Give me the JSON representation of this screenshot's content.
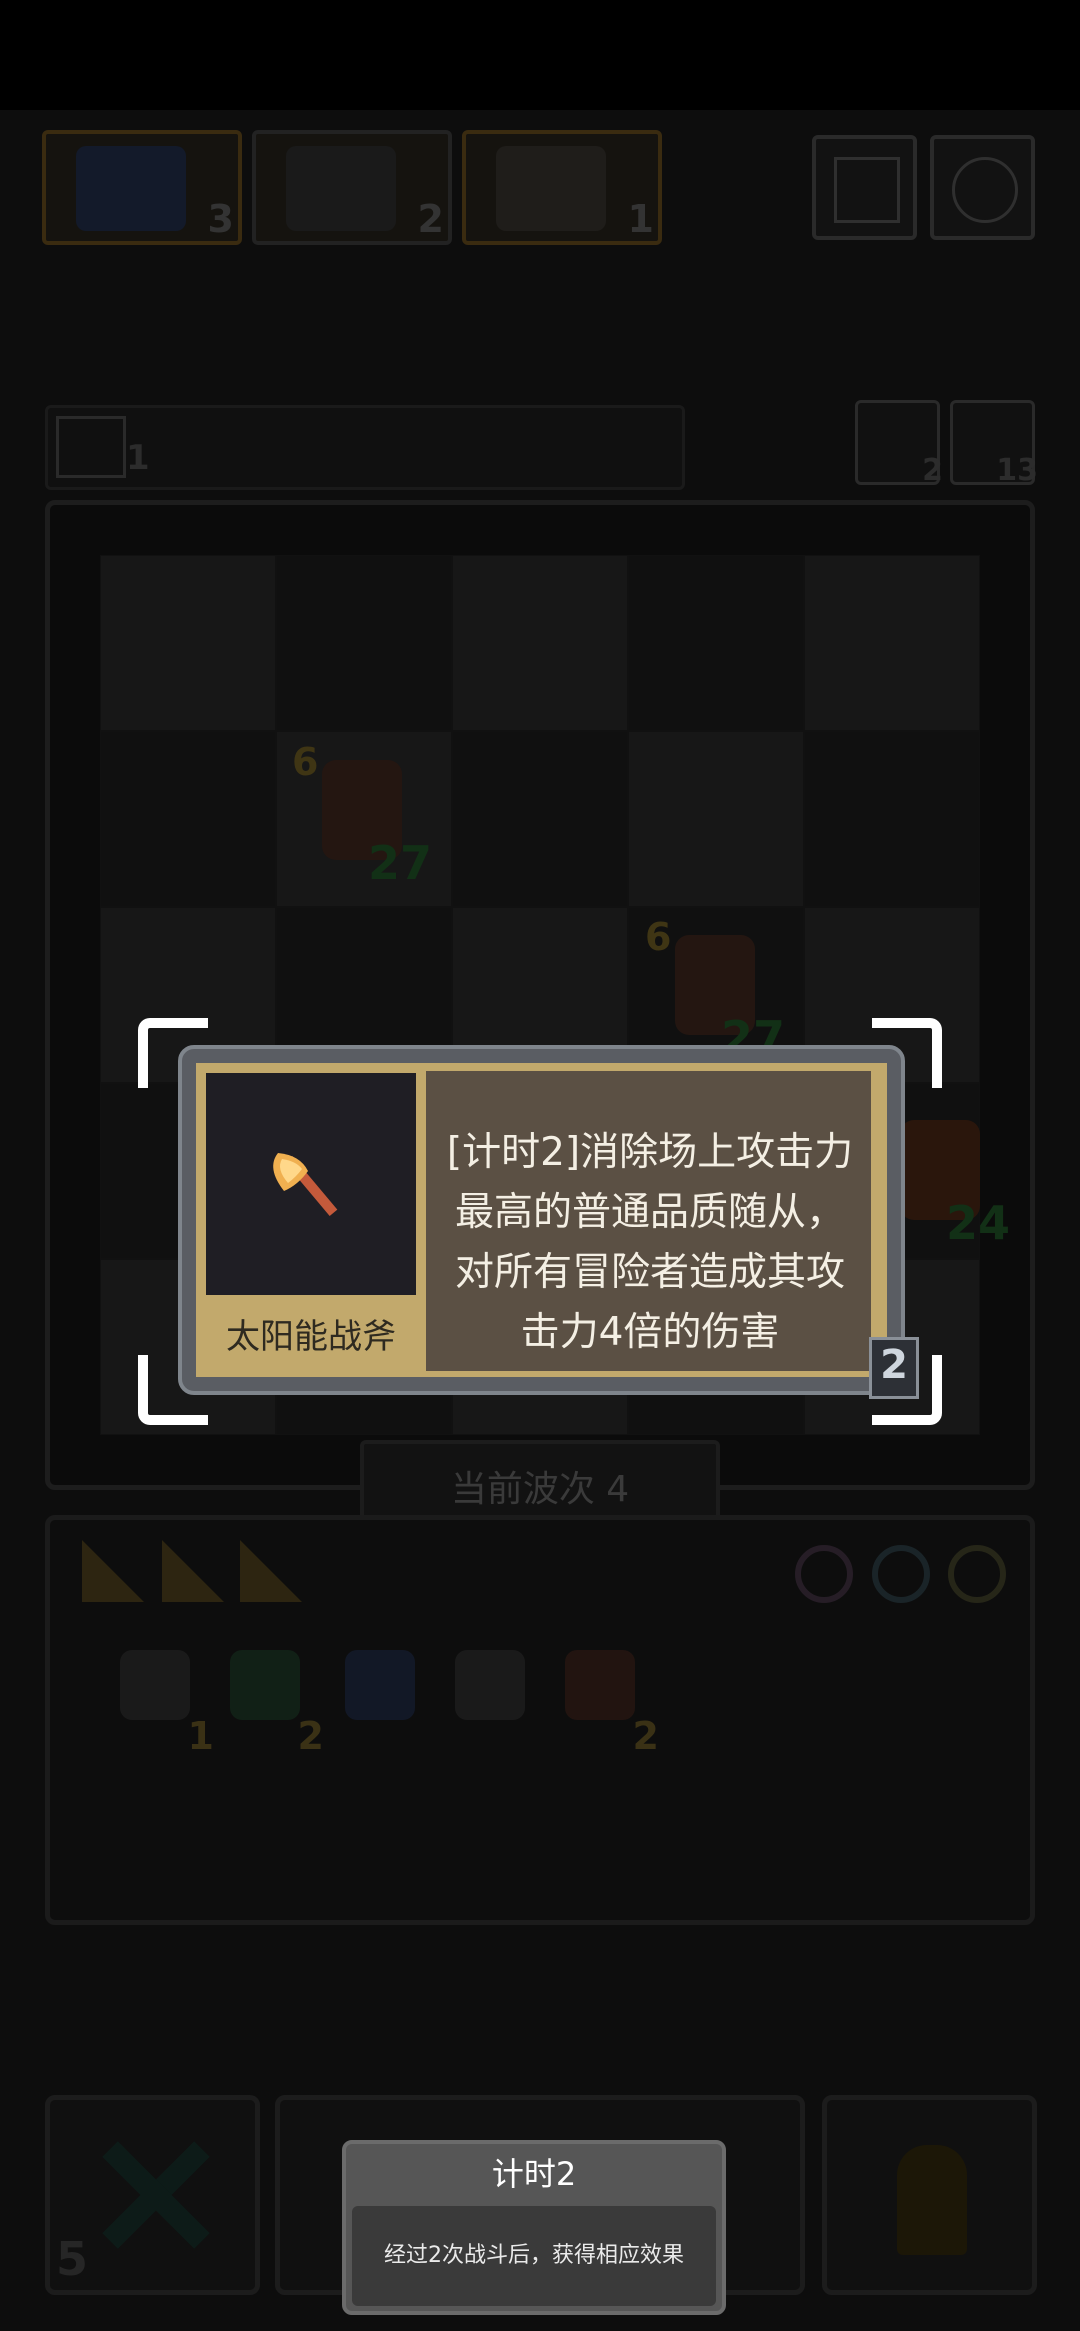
{
  "heroes": [
    {
      "name": "blue-golem",
      "count": "3"
    },
    {
      "name": "masked-mage",
      "count": "2"
    },
    {
      "name": "skeleton",
      "count": "1"
    }
  ],
  "top_right": {
    "help_label": "?",
    "settings_label": "gear"
  },
  "secondary_bar": {
    "mail_count": "1",
    "refresh_count": "2",
    "key_count": "13"
  },
  "board_units": [
    {
      "atk": "6",
      "hp": "27"
    },
    {
      "atk": "6",
      "hp": "27"
    },
    {
      "atk": "",
      "hp": "24"
    }
  ],
  "wave": {
    "label": "当前波次 4"
  },
  "inventory": [
    {
      "name": "bone-club",
      "count": "1"
    },
    {
      "name": "green-shield",
      "count": "2"
    },
    {
      "name": "blue-hat",
      "count": ""
    },
    {
      "name": "claw",
      "count": ""
    },
    {
      "name": "red-axe",
      "count": "2"
    }
  ],
  "bottom_bar": {
    "left_count": "5"
  },
  "popup": {
    "item_name": "太阳能战斧",
    "description": "[计时2]消除场上攻击力最高的普通品质随从，对所有冒险者造成其攻击力4倍的伤害",
    "count": "2"
  },
  "tooltip": {
    "title": "计时2",
    "body": "经过2次战斗后，获得相应效果"
  },
  "colors": {
    "popup_frame": "#5a5d63",
    "card_gold": "#c2a96c",
    "desc_bg": "#5b5044"
  }
}
